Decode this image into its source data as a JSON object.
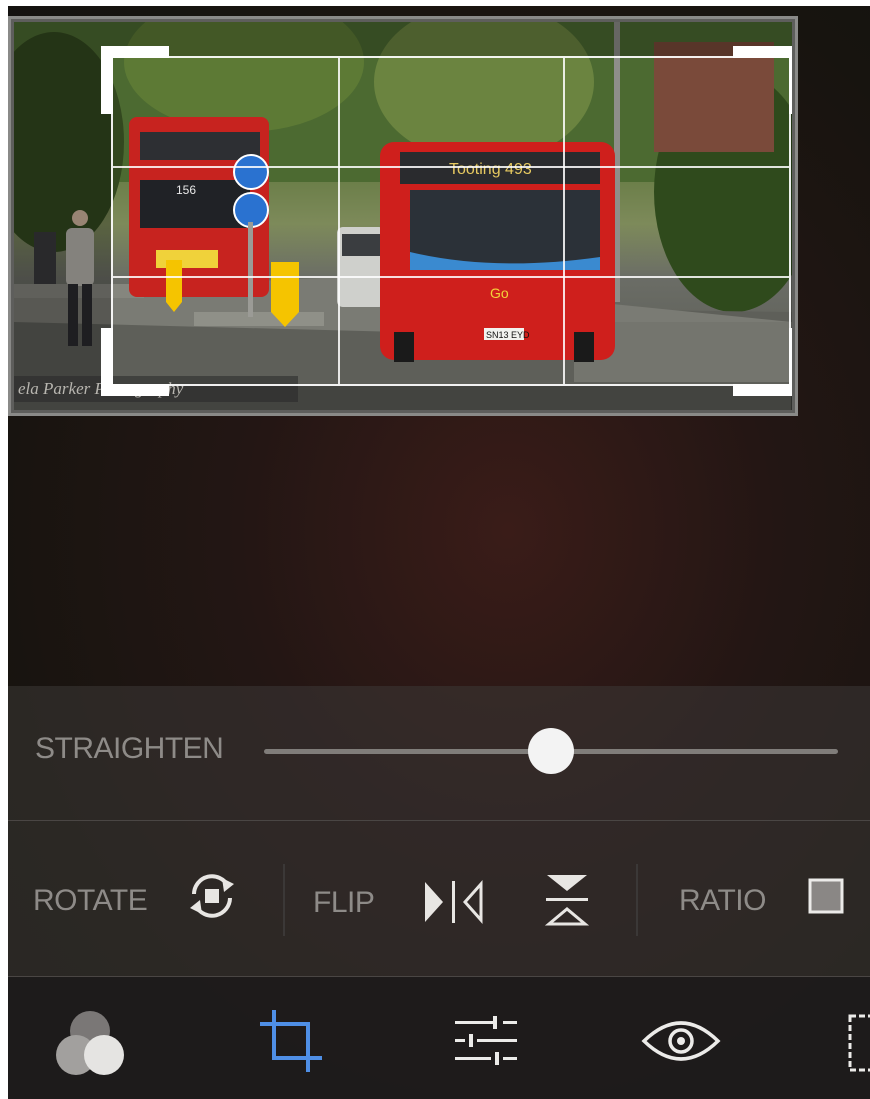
{
  "photo": {
    "watermark": "ela Parker Photography",
    "bus_front_destination": "Tooting 493",
    "bus_front_plate": "SN13 EYD",
    "bus_front_logo": "Go",
    "bus_back_route": "156"
  },
  "straighten": {
    "label": "STRAIGHTEN",
    "slider_value": 0.5
  },
  "tools": {
    "rotate_label": "ROTATE",
    "flip_label": "FLIP",
    "ratio_label": "RATIO"
  },
  "nav": {
    "items": [
      {
        "icon": "filters-icon"
      },
      {
        "icon": "crop-icon",
        "active": true
      },
      {
        "icon": "adjustments-icon"
      },
      {
        "icon": "eye-icon"
      },
      {
        "icon": "border-icon"
      }
    ]
  },
  "colors": {
    "accent": "#4f8fe6",
    "label": "#8e8b88",
    "knob": "#f3f3f3"
  }
}
